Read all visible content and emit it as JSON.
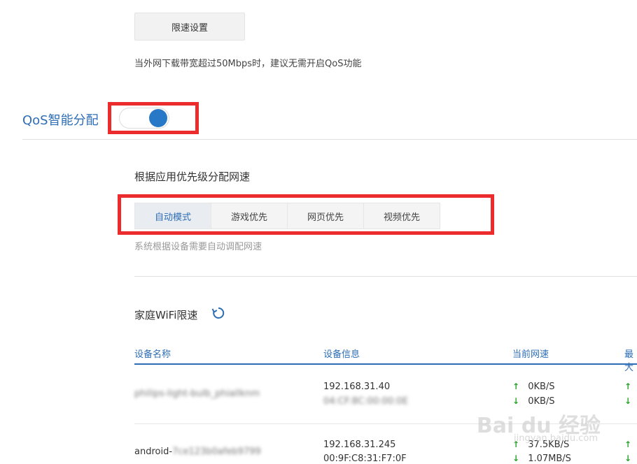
{
  "limit_button_label": "限速设置",
  "bandwidth_notice": "当外网下载带宽超过50Mbps时，建议无需开启QoS功能",
  "qos": {
    "title": "QoS智能分配",
    "enabled": true
  },
  "priority": {
    "subtitle": "根据应用优先级分配网速",
    "tabs": [
      {
        "label": "自动模式",
        "active": true
      },
      {
        "label": "游戏优先",
        "active": false
      },
      {
        "label": "网页优先",
        "active": false
      },
      {
        "label": "视频优先",
        "active": false
      }
    ],
    "description": "系统根据设备需要自动调配网速"
  },
  "wifi": {
    "title": "家庭WiFi限速",
    "refresh_icon": "refresh-icon",
    "columns": [
      "设备名称",
      "设备信息",
      "当前网速",
      "最大"
    ],
    "rows": [
      {
        "name": "philips-light-bulb_phiallknm",
        "ip": "192.168.31.40",
        "mac": "04:CF:8C:00:00:0E",
        "up": "0KB/S",
        "down": "0KB/S"
      },
      {
        "name": "android-7ce123b0afeb9799",
        "ip": "192.168.31.245",
        "mac": "00:9F:C8:31:F7:0F",
        "up": "37.5KB/S",
        "down": "1.07MB/S"
      }
    ]
  },
  "watermark": {
    "text": "Bai du 经验",
    "url": "jingyan.baidu.com"
  },
  "colors": {
    "accent": "#2d6db5",
    "toggle_on": "#2878c8",
    "highlight": "#ec2b2d",
    "arrow": "#2aa52a"
  }
}
